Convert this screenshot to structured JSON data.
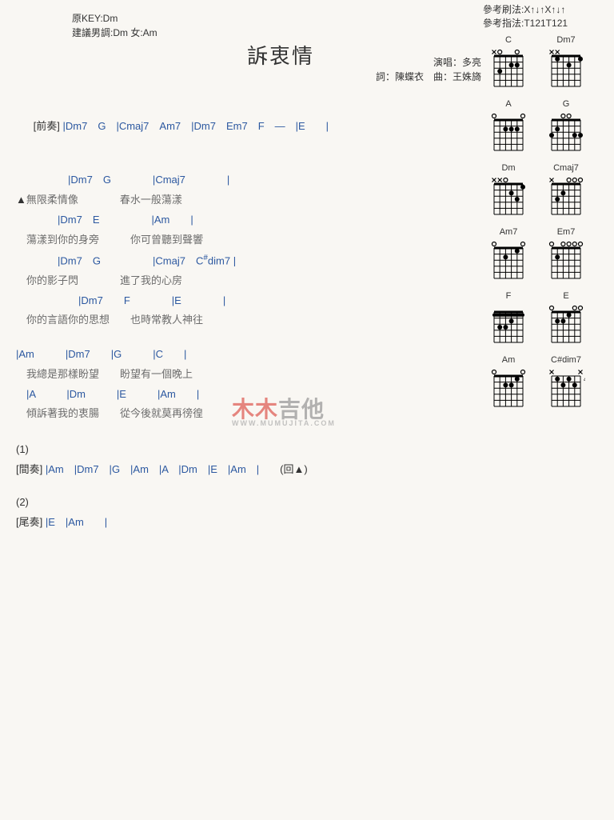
{
  "header": {
    "title": "訴衷情",
    "key_line1": "原KEY:Dm",
    "key_line2": "建議男調:Dm 女:Am",
    "credit1": "演唱：多亮",
    "credit2": "詞：陳蝶衣　曲：王姝旖",
    "ref1": "參考刷法:X↑↓↑X↑↓↑",
    "ref2": "參考指法:T121T121"
  },
  "intro": {
    "label": "[前奏]",
    "chords": "|Dm7　G　|Cmaj7　Am7　|Dm7　Em7　F　—　|E　　|"
  },
  "verse": [
    {
      "chords": "　　　　　|Dm7　G　　　　|Cmaj7　　　　|",
      "lyrics": "▲無限柔情像　　　　春水一般蕩漾"
    },
    {
      "chords": "　　　　|Dm7　E　　　　　|Am　　|",
      "lyrics": "　蕩漾到你的身旁　　　你可曾聽到聲響"
    },
    {
      "chords": "　　　　|Dm7　G　　　　　|Cmaj7　C#dim7 |",
      "lyrics": "　你的影子閃　　　　進了我的心房"
    },
    {
      "chords": "　　　　　　|Dm7　　F　　　　|E　　　　|",
      "lyrics": "　你的言語你的思想　　也時常教人神往"
    }
  ],
  "chorus": [
    {
      "chords": "|Am　　　|Dm7　　|G　　　|C　　|",
      "lyrics": "　我總是那樣盼望　　盼望有一個晚上"
    },
    {
      "chords": "　|A　　　|Dm　　　|E　　　|Am　　|",
      "lyrics": "　傾訴著我的衷腸　　從今後就莫再徬徨"
    }
  ],
  "interlude": {
    "num": "(1)",
    "label": "[間奏]",
    "chords": "|Am　|Dm7　|G　|Am　|A　|Dm　|E　|Am　|",
    "tail": "(回▲)"
  },
  "outro": {
    "num": "(2)",
    "label": "[尾奏]",
    "chords": "|E　|Am　　|"
  },
  "watermark": {
    "red": "木木",
    "gray": "吉他",
    "sub": "WWW.MUMUJITA.COM"
  },
  "diagrams": [
    {
      "name": "C",
      "open": [
        0,
        1,
        0,
        0,
        1,
        0
      ],
      "mute": [
        1,
        0,
        0,
        0,
        0,
        0
      ],
      "dots": [
        [
          2,
          4
        ],
        [
          3,
          2
        ],
        [
          2,
          5
        ]
      ]
    },
    {
      "name": "Dm7",
      "open": [
        0,
        0,
        0,
        0,
        0,
        0
      ],
      "mute": [
        1,
        1,
        0,
        0,
        0,
        0
      ],
      "dots": [
        [
          2,
          4
        ],
        [
          1,
          6
        ],
        [
          1,
          2
        ]
      ]
    },
    {
      "name": "A",
      "open": [
        1,
        0,
        0,
        0,
        0,
        1
      ],
      "mute": [
        0,
        0,
        0,
        0,
        0,
        0
      ],
      "dots": [
        [
          2,
          3
        ],
        [
          2,
          4
        ],
        [
          2,
          5
        ]
      ]
    },
    {
      "name": "G",
      "open": [
        0,
        0,
        1,
        1,
        0,
        0
      ],
      "mute": [
        0,
        0,
        0,
        0,
        0,
        0
      ],
      "dots": [
        [
          3,
          1
        ],
        [
          2,
          2
        ],
        [
          3,
          6
        ],
        [
          3,
          5
        ]
      ]
    },
    {
      "name": "Dm",
      "open": [
        0,
        0,
        1,
        0,
        0,
        0
      ],
      "mute": [
        1,
        1,
        0,
        0,
        0,
        0
      ],
      "dots": [
        [
          2,
          4
        ],
        [
          3,
          5
        ],
        [
          1,
          6
        ]
      ]
    },
    {
      "name": "Cmaj7",
      "open": [
        0,
        0,
        0,
        1,
        1,
        1
      ],
      "mute": [
        1,
        0,
        0,
        0,
        0,
        0
      ],
      "dots": [
        [
          3,
          2
        ],
        [
          2,
          3
        ]
      ]
    },
    {
      "name": "Am7",
      "open": [
        1,
        0,
        0,
        0,
        0,
        1
      ],
      "mute": [
        0,
        0,
        0,
        0,
        0,
        0
      ],
      "dots": [
        [
          2,
          3
        ],
        [
          1,
          5
        ]
      ]
    },
    {
      "name": "Em7",
      "open": [
        1,
        0,
        1,
        1,
        1,
        1
      ],
      "mute": [
        0,
        0,
        0,
        0,
        0,
        0
      ],
      "dots": [
        [
          2,
          2
        ]
      ]
    },
    {
      "name": "F",
      "open": [
        0,
        0,
        0,
        0,
        0,
        0
      ],
      "mute": [
        0,
        0,
        0,
        0,
        0,
        0
      ],
      "barre": [
        1,
        1,
        6
      ],
      "dots": [
        [
          3,
          2
        ],
        [
          3,
          3
        ],
        [
          2,
          4
        ]
      ]
    },
    {
      "name": "E",
      "open": [
        1,
        0,
        0,
        0,
        1,
        1
      ],
      "mute": [
        0,
        0,
        0,
        0,
        0,
        0
      ],
      "dots": [
        [
          2,
          2
        ],
        [
          2,
          3
        ],
        [
          1,
          4
        ]
      ]
    },
    {
      "name": "Am",
      "open": [
        1,
        0,
        0,
        0,
        0,
        1
      ],
      "mute": [
        0,
        0,
        0,
        0,
        0,
        0
      ],
      "dots": [
        [
          2,
          3
        ],
        [
          2,
          4
        ],
        [
          1,
          5
        ]
      ]
    },
    {
      "name": "C#dim7",
      "open": [
        0,
        0,
        0,
        0,
        0,
        0
      ],
      "mute": [
        1,
        0,
        0,
        0,
        0,
        1
      ],
      "fret": 4,
      "dots": [
        [
          1,
          2
        ],
        [
          2,
          3
        ],
        [
          1,
          4
        ],
        [
          2,
          5
        ]
      ]
    }
  ]
}
